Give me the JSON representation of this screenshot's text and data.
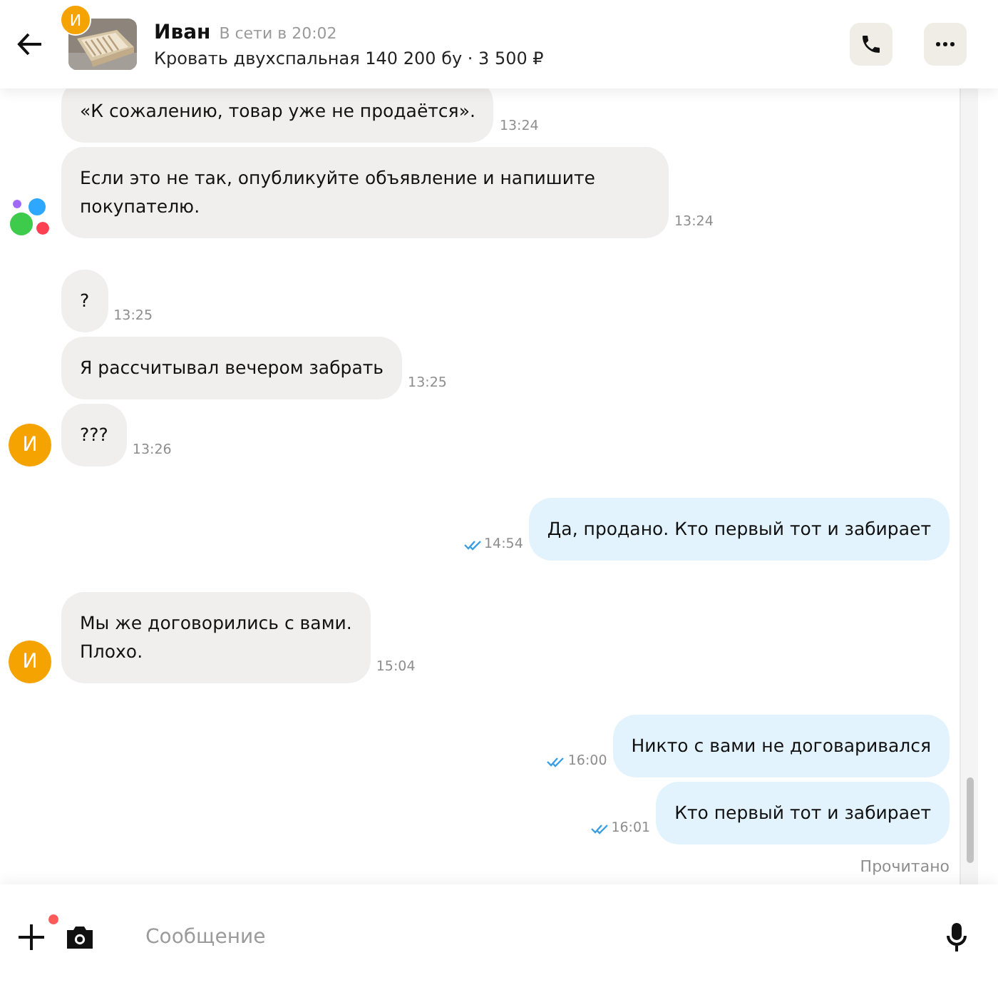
{
  "header": {
    "avatar_letter": "И",
    "name": "Иван",
    "status": "В сети в 20:02",
    "listing": "Кровать двухспальная 140 200 бу · 3 500 ₽"
  },
  "groups": [
    {
      "kind": "system",
      "messages": [
        {
          "text": "«К сожалению, товар уже не продаётся».",
          "time": "13:24"
        },
        {
          "text": "Если это не так, опубликуйте объявление и напишите покупателю.",
          "time": "13:24"
        }
      ]
    },
    {
      "kind": "contact",
      "avatar_letter": "И",
      "messages": [
        {
          "text": "?",
          "time": "13:25"
        },
        {
          "text": "Я рассчитывал вечером забрать",
          "time": "13:25"
        },
        {
          "text": "???",
          "time": "13:26"
        }
      ]
    },
    {
      "kind": "me",
      "messages": [
        {
          "text": "Да, продано. Кто первый тот и забирает",
          "time": "14:54",
          "read": true
        }
      ]
    },
    {
      "kind": "contact",
      "avatar_letter": "И",
      "messages": [
        {
          "text": "Мы же договорились с вами.\nПлохо.",
          "time": "15:04"
        }
      ]
    },
    {
      "kind": "me",
      "messages": [
        {
          "text": "Никто с вами не договаривался",
          "time": "16:00",
          "read": true
        },
        {
          "text": "Кто первый тот и забирает",
          "time": "16:01",
          "read": true
        }
      ],
      "receipt": "Прочитано"
    }
  ],
  "composer": {
    "placeholder": "Сообщение",
    "attachment_badge": true
  }
}
